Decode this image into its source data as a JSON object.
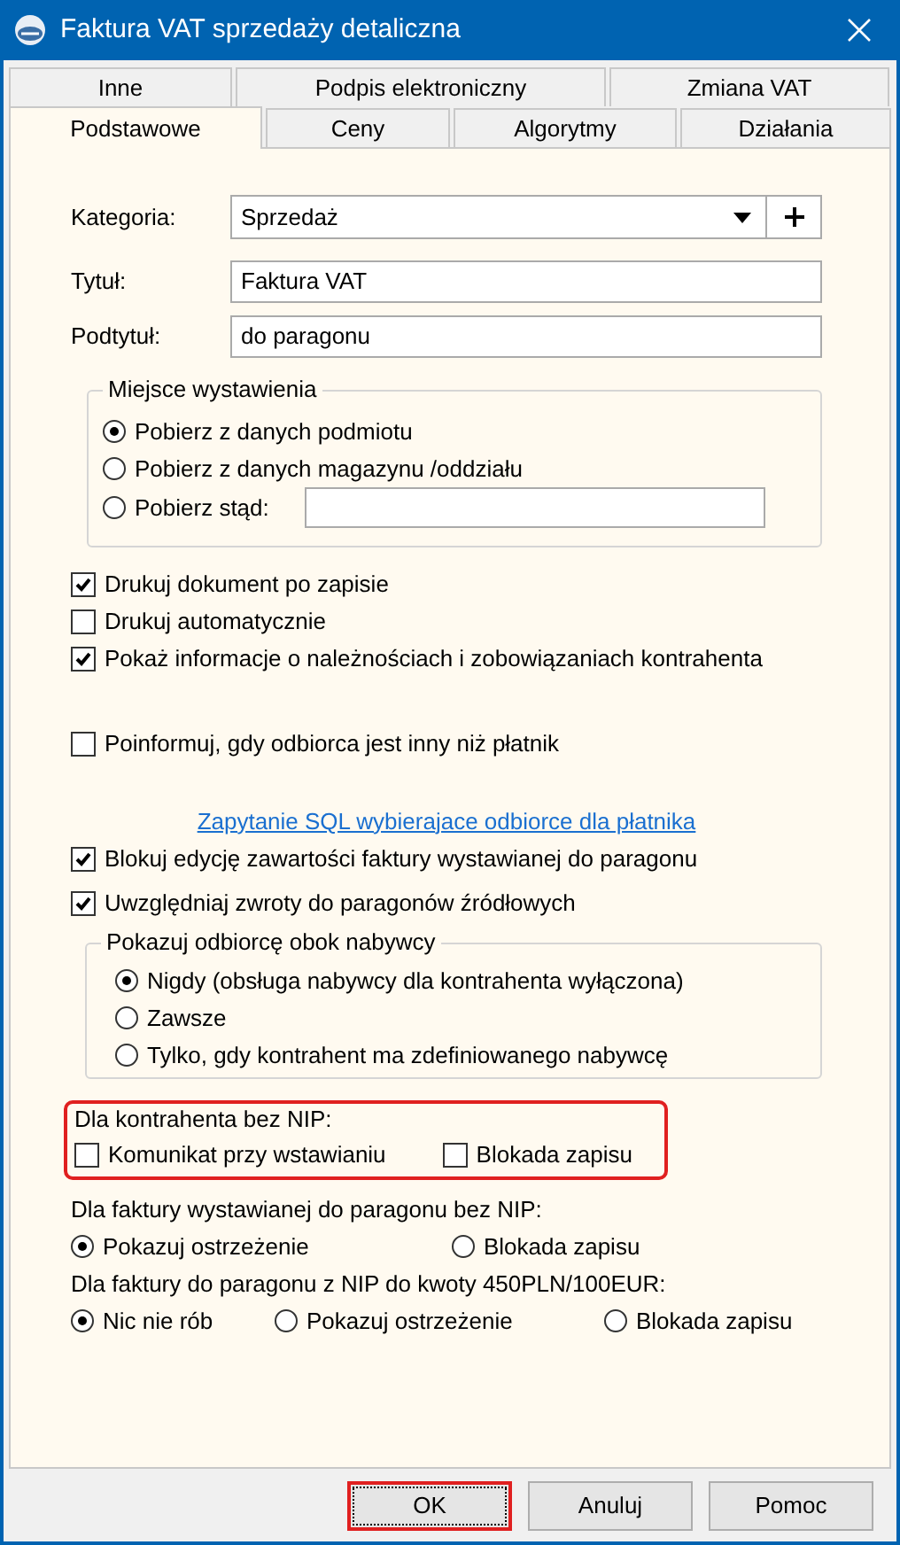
{
  "window": {
    "title": "Faktura VAT sprzedaży detaliczna"
  },
  "tab_rows": [
    [
      {
        "label": "Inne",
        "selected": false
      },
      {
        "label": "Podpis elektroniczny",
        "selected": false
      },
      {
        "label": "Zmiana VAT",
        "selected": false
      }
    ],
    [
      {
        "label": "Podstawowe",
        "selected": true
      },
      {
        "label": "Ceny",
        "selected": false
      },
      {
        "label": "Algorytmy",
        "selected": false
      },
      {
        "label": "Działania",
        "selected": false
      }
    ]
  ],
  "fields": [
    {
      "kind": "combo",
      "label": "Kategoria:",
      "value": "Sprzedaż"
    },
    {
      "kind": "text",
      "label": "Tytuł:",
      "value": "Faktura VAT"
    },
    {
      "kind": "text",
      "label": "Podtytuł:",
      "value": "do paragonu"
    }
  ],
  "place_group": {
    "title": "Miejsce wystawienia",
    "options": [
      {
        "label": "Pobierz z danych podmiotu",
        "selected": true
      },
      {
        "label": "Pobierz z danych magazynu /oddziału",
        "selected": false
      },
      {
        "label": "Pobierz stąd:",
        "selected": false,
        "kind": "with_field"
      }
    ]
  },
  "print_options": [
    {
      "label": "Drukuj dokument po zapisie",
      "checked": true
    },
    {
      "label": "Drukuj automatycznie",
      "checked": false
    },
    {
      "label": "Pokaż informacje o należnościach i zobowiązaniach kontrahenta",
      "checked": true
    }
  ],
  "notify_option": {
    "label": "Poinformuj, gdy odbiorca jest inny niż płatnik",
    "checked": false
  },
  "sql_link": "Zapytanie SQL wybierajace odbiorce dla płatnika",
  "receipt_options": [
    {
      "label": "Blokuj edycję zawartości faktury wystawianej do paragonu",
      "checked": true
    },
    {
      "label": "Uwzględniaj zwroty do paragonów źródłowych",
      "checked": true
    }
  ],
  "recipient_group": {
    "title": "Pokazuj odbiorcę obok nabywcy",
    "options": [
      {
        "label": "Nigdy (obsługa nabywcy dla kontrahenta wyłączona)",
        "selected": true
      },
      {
        "label": "Zawsze",
        "selected": false
      },
      {
        "label": "Tylko, gdy kontrahent ma zdefiniowanego nabywcę",
        "selected": false
      }
    ]
  },
  "no_nip_group": {
    "title": "Dla kontrahenta bez NIP:",
    "highlighted": true,
    "options": [
      {
        "label": "Komunikat przy wstawianiu",
        "checked": false
      },
      {
        "label": "Blokada zapisu",
        "checked": false
      }
    ]
  },
  "radio_rows": [
    {
      "title": "Dla faktury wystawianej do paragonu bez NIP:",
      "options": [
        {
          "label": "Pokazuj ostrzeżenie",
          "selected": true
        },
        {
          "label": "Blokada zapisu",
          "selected": false
        }
      ]
    },
    {
      "title": "Dla faktury do paragonu z NIP do kwoty 450PLN/100EUR:",
      "options": [
        {
          "label": "Nic nie rób",
          "selected": true
        },
        {
          "label": "Pokazuj ostrzeżenie",
          "selected": false
        },
        {
          "label": "Blokada zapisu",
          "selected": false
        }
      ]
    }
  ],
  "buttons": [
    {
      "label": "OK",
      "default": true,
      "highlighted": true
    },
    {
      "label": "Anuluj",
      "default": false,
      "highlighted": false
    },
    {
      "label": "Pomoc",
      "default": false,
      "highlighted": false
    }
  ]
}
